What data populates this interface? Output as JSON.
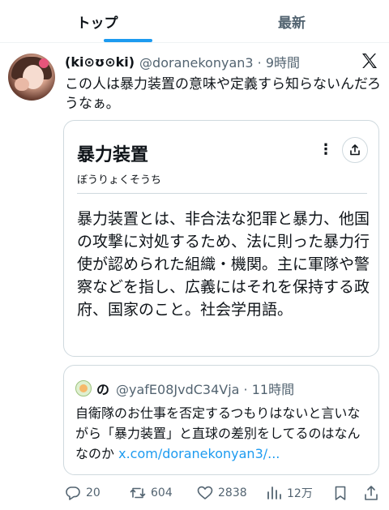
{
  "tabs": [
    {
      "label": "トップ",
      "active": true
    },
    {
      "label": "最新",
      "active": false
    }
  ],
  "tweet": {
    "display_name": "(ki⊙ʊ⊙ki)",
    "handle_time": "@doranekonyan3 · 9時間",
    "text": "この人は暴力装置の意味や定義すら知らないんだろうなぁ。"
  },
  "card": {
    "title": "暴力装置",
    "reading": "ぼうりょくそうち",
    "more_icon_glyph": "⋮",
    "body": "暴力装置とは、非合法な犯罪と暴力、他国の攻撃に対処するため、法に則った暴力行使が認められた組織・機関。主に軍隊や警察などを指し、広義にはそれを保持する政府、国家のこと。社会学用語。"
  },
  "quote": {
    "name": "の",
    "handle_time": "@yafE08JvdC34Vja · 11時間",
    "text": "自衛隊のお仕事を否定するつもりはないと言いながら「暴力装置」と直球の差別をしてるのはなんなのか ",
    "link": "x.com/doranekonyan3/..."
  },
  "actions": {
    "reply_count": "20",
    "retweet_count": "604",
    "like_count": "2838",
    "views_count": "12万"
  },
  "colors": {
    "accent": "#1d9bf0",
    "text": "#0f1419",
    "secondary": "#536471",
    "border": "#cfd9de"
  },
  "icons": [
    "x-logo-icon",
    "more-icon",
    "share-icon",
    "reply-icon",
    "retweet-icon",
    "like-icon",
    "views-icon",
    "bookmark-icon",
    "share-action-icon"
  ]
}
